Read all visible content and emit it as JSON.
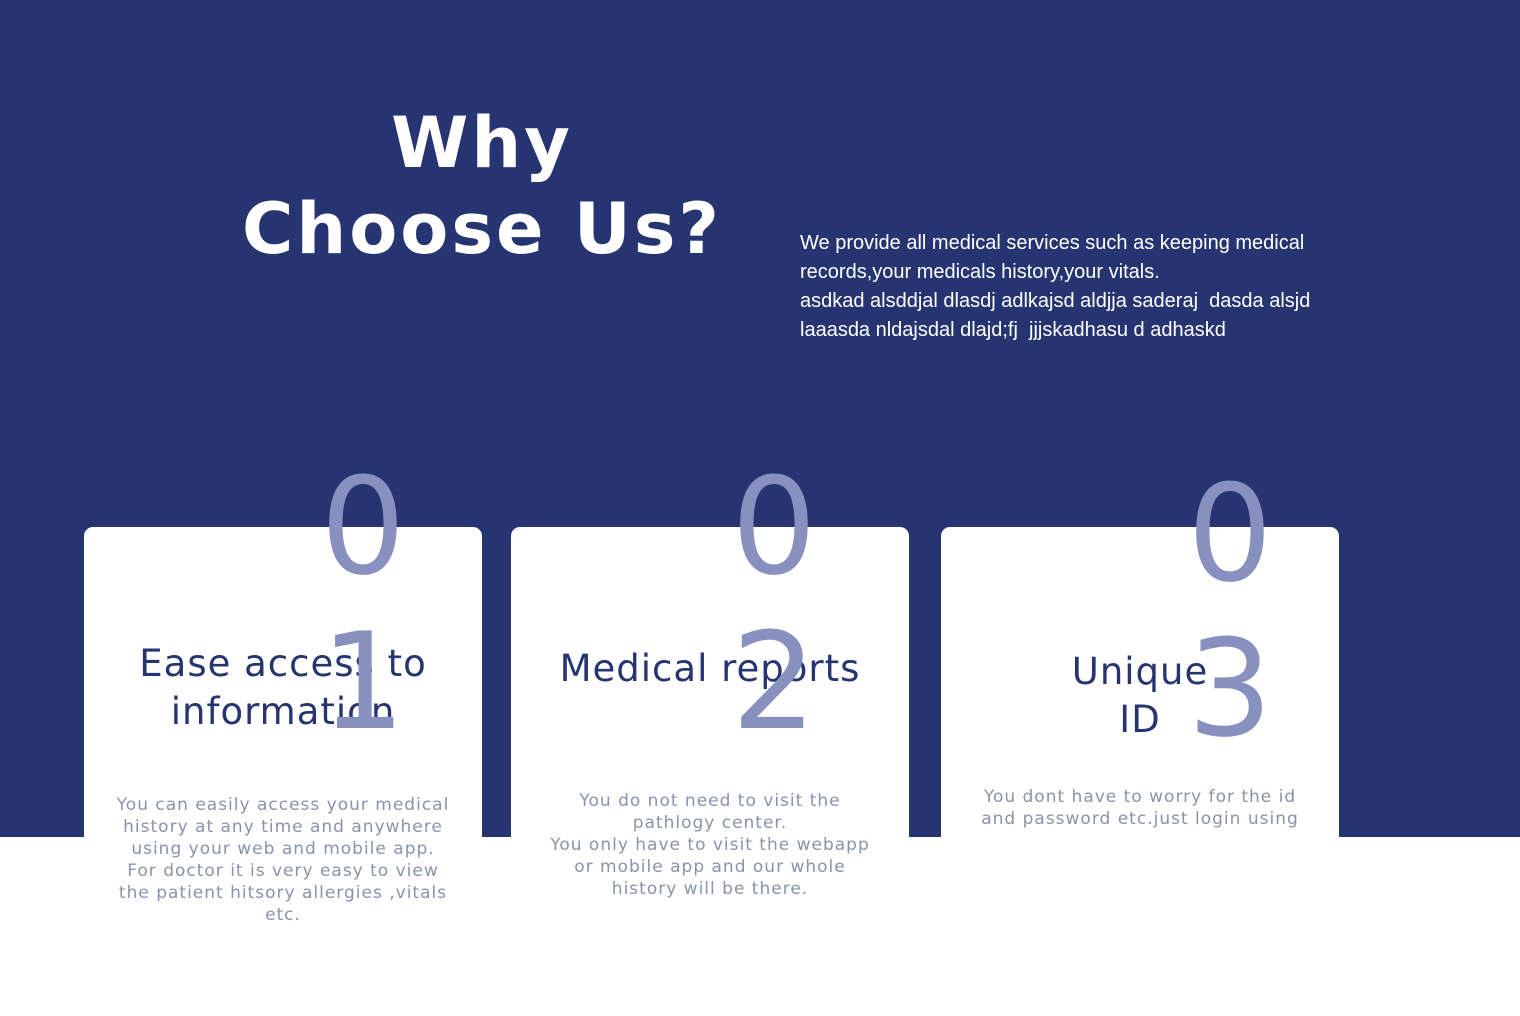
{
  "hero": {
    "title": "Why Choose Us?",
    "description": [
      "We provide all medical services such as keeping medical records,your medicals history,your vitals.",
      "asdkad alsddjal dlasdj adlkajsd aldjja saderaj  dasda alsjd laaasda nldajsdal dlajd;fj  jjjskadhasu d adhaskd"
    ]
  },
  "colors": {
    "hero_background": "#263571",
    "number_color": "#8890c0",
    "card_title_color": "#263571",
    "card_text_color": "#8a93a8"
  },
  "features": [
    {
      "number": "01",
      "title": "Ease access to information",
      "text": [
        "You can easily access your medical history at any time and anywhere using your web and mobile app.",
        "For doctor it is very easy  to view the patient hitsory allergies ,vitals etc."
      ]
    },
    {
      "number": "02",
      "title": "Medical reports",
      "text": [
        "You do not need to visit the pathlogy center.",
        "You only have to visit the webapp or mobile app and our whole history will be there."
      ]
    },
    {
      "number": "03",
      "title": "Unique ID",
      "text": [
        "You dont have to worry for the id and password etc.just login using"
      ]
    }
  ]
}
